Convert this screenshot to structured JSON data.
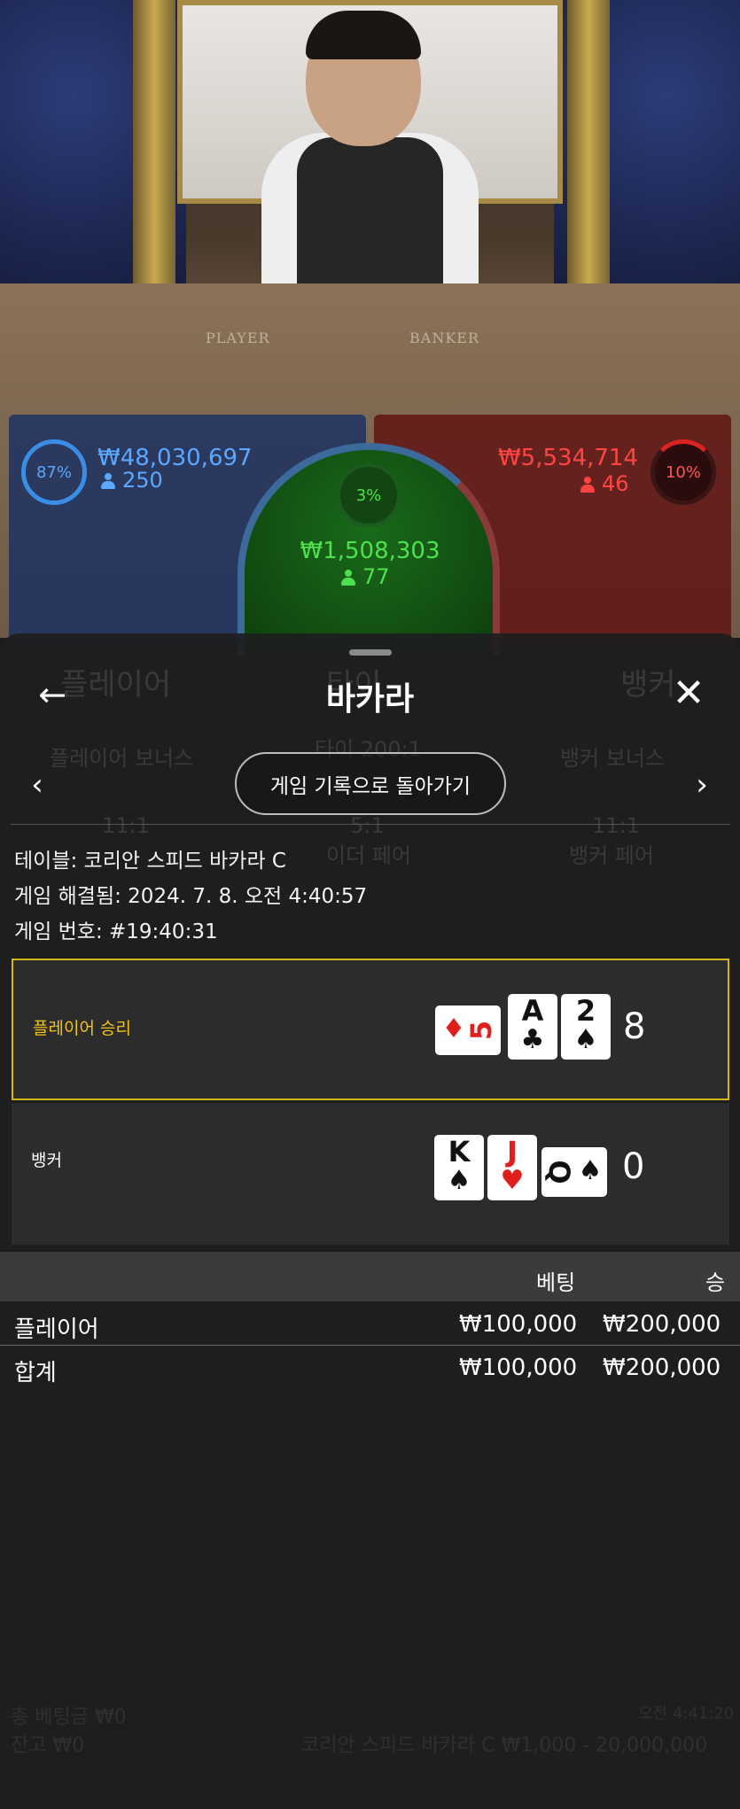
{
  "video": {
    "table_labels": {
      "player": "PLAYER",
      "banker": "BANKER"
    },
    "player_bet": {
      "percent": "87%",
      "amount": "₩48,030,697",
      "count": "250"
    },
    "tie_bet": {
      "percent": "3%",
      "amount": "₩1,508,303",
      "count": "77"
    },
    "banker_bet": {
      "percent": "10%",
      "amount": "₩5,534,714",
      "count": "46"
    }
  },
  "sheet": {
    "title": "바카라",
    "back_icon": "arrow-left-icon",
    "close_icon": "close-icon",
    "return_button": "게임 기록으로 돌아가기",
    "info": {
      "table": "테이블: 코리안 스피드 바카라 C",
      "resolved": "게임 해결됨: 2024. 7. 8. 오전 4:40:57",
      "game_number": "게임 번호: #19:40:31"
    },
    "results": [
      {
        "label": "플레이어 승리",
        "score": "8",
        "cards": [
          {
            "rank": "5",
            "suit": "♦",
            "color": "red"
          },
          {
            "rank": "A",
            "suit": "♣",
            "color": "black"
          },
          {
            "rank": "2",
            "suit": "♠",
            "color": "black"
          }
        ]
      },
      {
        "label": "뱅커",
        "score": "0",
        "cards": [
          {
            "rank": "K",
            "suit": "♠",
            "color": "black"
          },
          {
            "rank": "J",
            "suit": "♥",
            "color": "red"
          },
          {
            "rank": "Q",
            "suit": "♠",
            "color": "black"
          }
        ]
      }
    ],
    "bets_table": {
      "headers": {
        "bet": "베팅",
        "win": "승"
      },
      "rows": [
        {
          "name": "플레이어",
          "bet": "₩100,000",
          "win": "₩200,000"
        },
        {
          "name": "합계",
          "bet": "₩100,000",
          "win": "₩200,000"
        }
      ]
    }
  },
  "background_ui": {
    "player_label": "플레이어",
    "banker_label": "뱅커",
    "tie_label": "타이",
    "player_bonus": "플레이어 보너스",
    "tie_odds": "타이 200:1",
    "banker_bonus": "뱅커 보너스",
    "player_pair": "11:1",
    "either_pair": "5:1",
    "either_pair_label": "이더 페어",
    "banker_pair": "11:1",
    "banker_pair_label": "뱅커 페어",
    "total_bet": "총 베팅금 ₩0",
    "balance": "잔고 ₩0",
    "time": "오전 4:41:20",
    "table_limits": "코리안 스피드 바카라 C ₩1,000 - 20,000,000"
  },
  "colors": {
    "player_blue": "#5aa8ff",
    "banker_red": "#ff4444",
    "tie_green": "#4ee04e",
    "winner_border": "#d4b619",
    "winner_label": "#f0c419"
  }
}
